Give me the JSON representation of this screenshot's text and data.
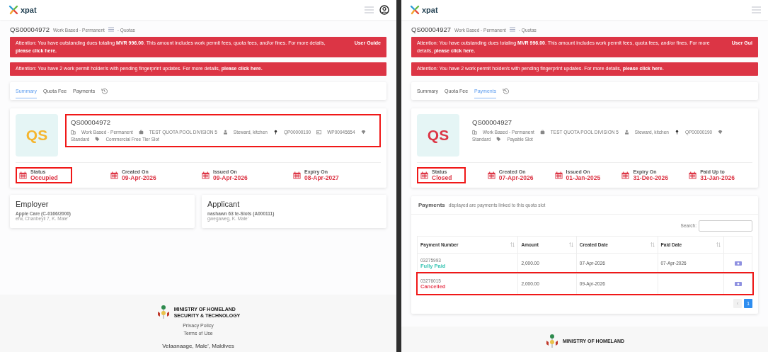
{
  "screens": [
    {
      "brand": "xpat",
      "breadcrumb": {
        "code": "QS00004972",
        "type": "Work Based - Permanent",
        "link": "- Quotas"
      },
      "alerts": [
        {
          "text": "Attention: You have outstanding dues totaling **MVR 996.00**. This amount includes work permit fees, quota fees, and/or fines. For more details,",
          "link": "please click here.",
          "aside": "User Guide"
        },
        {
          "text": "Attention: You have 2 work permit holder/s with pending fingerprint updates. For more details,",
          "link": "please click here."
        }
      ],
      "tabs": [
        {
          "label": "Summary",
          "selected": true
        },
        {
          "label": "Quota Fee",
          "selected": false
        },
        {
          "label": "Payments",
          "selected": false
        }
      ],
      "quota": {
        "highlighted": true,
        "avatar": {
          "text": "QS",
          "color": "#f5b52e"
        },
        "code": "QS00004972",
        "meta": [
          {
            "kind": "category",
            "text": "Work Based - Permanent"
          },
          {
            "kind": "pool",
            "text": "TEST QUOTA POOL DIVISION 5"
          },
          {
            "kind": "occupation",
            "text": "Steward, kitchen"
          },
          {
            "kind": "permit",
            "text": "QP00000190"
          },
          {
            "kind": "card",
            "text": "WP00945654"
          },
          {
            "kind": "grade",
            "text": "Standard"
          },
          {
            "kind": "slot",
            "text": "Commercial Free Tier Slot"
          }
        ]
      },
      "stats": [
        {
          "label": "Status",
          "value": "Occupied",
          "highlighted": true
        },
        {
          "label": "Created On",
          "value": "09-Apr-2026",
          "highlighted": false
        },
        {
          "label": "Issued On",
          "value": "09-Apr-2026",
          "highlighted": false
        },
        {
          "label": "Expiry On",
          "value": "08-Apr-2027",
          "highlighted": false
        }
      ],
      "parties": [
        {
          "title": "Employer",
          "name": "Apple Care (C-0166/2000)",
          "address": "efw, Chanbeyli 7, K. Male'"
        },
        {
          "title": "Applicant",
          "name": "nashawn 63 te-Slots (A000111)",
          "address": "gwegaweg, K. Male'"
        }
      ],
      "footer": {
        "ministry": [
          "MINISTRY OF HOMELAND",
          "SECURITY & TECHNOLOGY"
        ],
        "links": [
          "Privacy Policy",
          "Terms of Use"
        ],
        "address": "Velaanaage, Male', Maldives"
      }
    },
    {
      "brand": "xpat",
      "breadcrumb": {
        "code": "QS00004927",
        "type": "Work Based - Permanent",
        "link": "- Quotas"
      },
      "alerts": [
        {
          "text": "Attention: You have outstanding dues totaling **MVR 996.00**. This amount includes work permit fees, quota fees, and/or fines. For more details,",
          "link": "please click here.",
          "aside": "User Gui"
        },
        {
          "text": "Attention: You have 2 work permit holder/s with pending fingerprint updates. For more details,",
          "link": "please click here."
        }
      ],
      "tabs": [
        {
          "label": "Summary",
          "selected": false
        },
        {
          "label": "Quota Fee",
          "selected": false
        },
        {
          "label": "Payments",
          "selected": true
        }
      ],
      "quota": {
        "highlighted": false,
        "avatar": {
          "text": "QS",
          "color": "#dc3545"
        },
        "code": "QS00004927",
        "meta": [
          {
            "kind": "category",
            "text": "Work Based - Permanent"
          },
          {
            "kind": "pool",
            "text": "TEST QUOTA POOL DIVISION 5"
          },
          {
            "kind": "occupation",
            "text": "Steward, kitchen"
          },
          {
            "kind": "permit",
            "text": "QP00000190"
          },
          {
            "kind": "grade",
            "text": "Standard"
          },
          {
            "kind": "slot",
            "text": "Payable Slot"
          }
        ]
      },
      "stats": [
        {
          "label": "Status",
          "value": "Closed",
          "highlighted": true
        },
        {
          "label": "Created On",
          "value": "07-Apr-2026",
          "highlighted": false
        },
        {
          "label": "Issued On",
          "value": "01-Jan-2025",
          "highlighted": false
        },
        {
          "label": "Expiry On",
          "value": "31-Dec-2026",
          "highlighted": false
        },
        {
          "label": "Paid Up to",
          "value": "31-Jan-2026",
          "highlighted": false
        }
      ],
      "payments": {
        "title": "Payments",
        "subtitle": "displayed are payments linked to this quota slot",
        "search_label": "Search:",
        "columns": [
          "Payment Number",
          "Amount",
          "Created Date",
          "Paid Date"
        ],
        "rows": [
          {
            "number": "03275993",
            "status": "Fully Paid",
            "color": "#3cc6b4",
            "amount": "2,000.00",
            "created": "07-Apr-2026",
            "paid": "07-Apr-2026",
            "highlighted": false
          },
          {
            "number": "03276015",
            "status": "Cancelled",
            "color": "#e8475a",
            "amount": "2,000.00",
            "created": "09-Apr-2026",
            "highlighted": true
          }
        ],
        "prev": "‹",
        "pages": [
          {
            "label": "1",
            "selected": true
          }
        ]
      },
      "footer": {
        "ministry": [
          "MINISTRY OF HOMELAND"
        ]
      }
    }
  ]
}
